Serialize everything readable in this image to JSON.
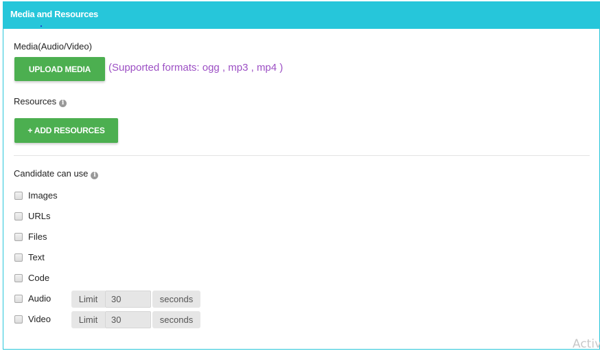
{
  "panel": {
    "title": "Media and Resources",
    "header_color": "#26c6da"
  },
  "media": {
    "label": "Media(Audio/Video)",
    "upload_button": "UPLOAD MEDIA",
    "supported_formats": "(Supported formats: ogg , mp3 , mp4 )"
  },
  "resources": {
    "label": "Resources",
    "info_icon": "info-icon",
    "add_button": "+ ADD RESOURCES"
  },
  "candidate": {
    "label": "Candidate can use",
    "info_icon": "info-icon",
    "options": [
      {
        "label": "Images",
        "checked": false
      },
      {
        "label": "URLs",
        "checked": false
      },
      {
        "label": "Files",
        "checked": false
      },
      {
        "label": "Text",
        "checked": false
      },
      {
        "label": "Code",
        "checked": false
      },
      {
        "label": "Audio",
        "checked": false,
        "limit_label": "Limit",
        "limit_value": "30",
        "unit": "seconds"
      },
      {
        "label": "Video",
        "checked": false,
        "limit_label": "Limit",
        "limit_value": "30",
        "unit": "seconds"
      }
    ]
  },
  "colors": {
    "accent": "#26c6da",
    "button": "#4caf50",
    "formats_text": "#9c4fc4"
  },
  "watermark": "Activ"
}
